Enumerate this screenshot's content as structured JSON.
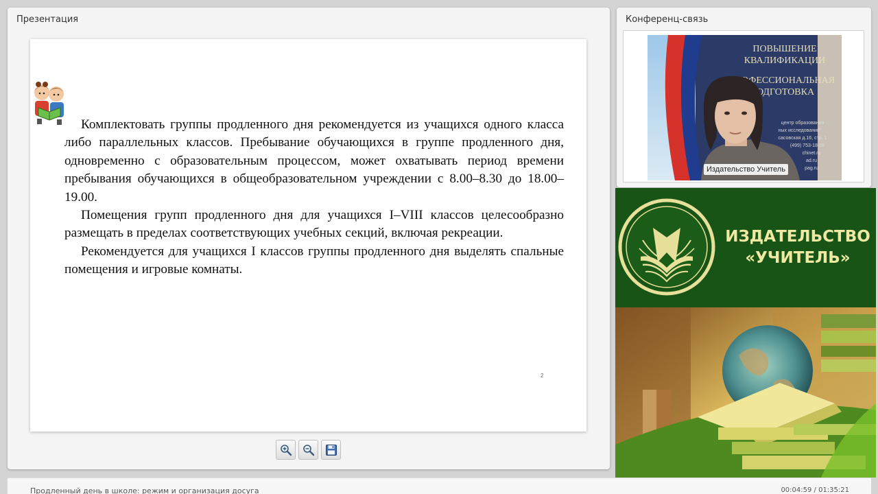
{
  "presentation": {
    "title": "Презентация",
    "slide": {
      "paragraphs": [
        "Комплектовать группы продленного дня рекомендуется из учащихся одного класса либо параллельных классов. Пребывание обучающихся в группе продленного дня, одновременно с образовательным процессом, может охватывать период времени пребывания обучающихся в общеобразовательном учреждении с 8.00–8.30 до 18.00–19.00.",
        "Помещения групп продленного дня для учащихся I–VIII классов целесообразно размещать в пределах соответствующих учебных секций, включая рекреации.",
        "Рекомендуется для учащихся I классов группы продленного дня выделять спальные помещения и игровые комнаты."
      ],
      "mark": "2"
    },
    "toolbar": [
      {
        "name": "zoom-in-button",
        "icon": "zoom-in-icon"
      },
      {
        "name": "zoom-out-button",
        "icon": "zoom-out-icon"
      },
      {
        "name": "save-button",
        "icon": "floppy-disk-icon"
      }
    ]
  },
  "conference": {
    "title": "Конференц-связь",
    "participant_label": "Издательство Учитель",
    "backdrop_lines": [
      "ПОВЫШЕНИЕ",
      "КВАЛИФИКАЦИИ",
      "ПРОФЕССИОНАЛЬНАЯ",
      "ПОДГОТОВКА"
    ],
    "backdrop_small": [
      "центр образования",
      "ных исследований\"",
      "сасовская д.16, стр. 1",
      "(499) 753-18-08",
      "chinet.ru",
      "ad.ru",
      "pag.ru"
    ]
  },
  "brand": {
    "line1": "ИЗДАТЕЛЬСТВО",
    "line2": "«УЧИТЕЛЬ»",
    "colors": {
      "background": "#185416",
      "text": "#f0e9a3"
    }
  },
  "status": {
    "course_title": "Продленный день в школе: режим и организация досуга",
    "time": "00:04:59 / 01:35:21"
  }
}
